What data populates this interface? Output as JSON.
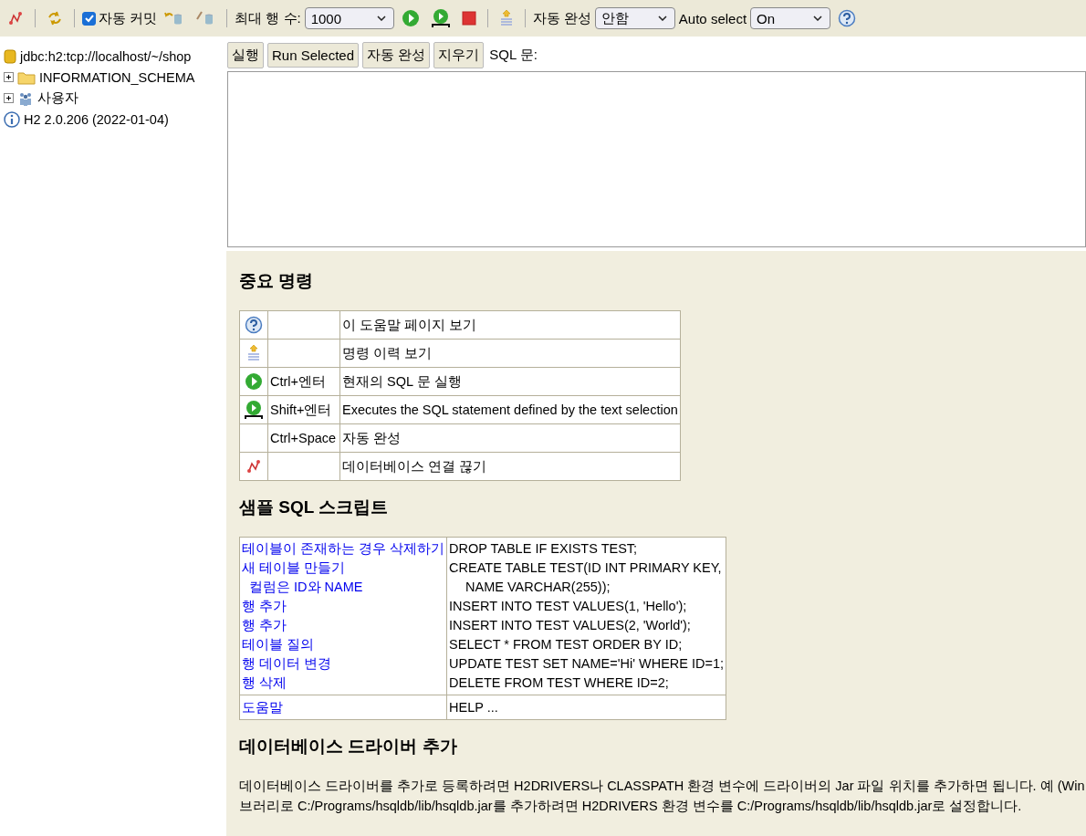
{
  "toolbar": {
    "auto_commit": {
      "label": "자동 커밋",
      "checked": true
    },
    "max_rows": {
      "label": "최대 행 수:",
      "value": "1000"
    },
    "autocomplete": {
      "label": "자동 완성",
      "value": "안함"
    },
    "auto_select": {
      "label": "Auto select",
      "value": "On"
    }
  },
  "tree": [
    {
      "kind": "connection",
      "label": "jdbc:h2:tcp://localhost/~/shop"
    },
    {
      "kind": "folder",
      "label": "INFORMATION_SCHEMA",
      "expanded": false
    },
    {
      "kind": "users",
      "label": "사용자",
      "expanded": false
    },
    {
      "kind": "info",
      "label": "H2 2.0.206 (2022-01-04)"
    }
  ],
  "editor": {
    "buttons": [
      "실행",
      "Run Selected",
      "자동 완성",
      "지우기"
    ],
    "label": "SQL 문:"
  },
  "help": {
    "title": "중요 명령",
    "commands": [
      {
        "kind": "help",
        "description": "이 도움말 페이지 보기"
      },
      {
        "kind": "history",
        "description": "명령 이력 보기"
      },
      {
        "kind": "run",
        "shortcut": "Ctrl+엔터",
        "description": "현재의 SQL 문 실행"
      },
      {
        "kind": "run_selected",
        "shortcut": "Shift+엔터",
        "description": "Executes the SQL statement defined by the text selection"
      },
      {
        "kind": "none",
        "shortcut": "Ctrl+Space",
        "description": "자동 완성"
      },
      {
        "kind": "disconnect",
        "description": "데이터베이스 연결 끊기"
      }
    ],
    "sample_title": "샘플 SQL 스크립트",
    "sample_rows": [
      {
        "label": "테이블이 존재하는 경우 삭제하기",
        "sql": "DROP TABLE IF EXISTS TEST;",
        "continuation": false
      },
      {
        "label": "새 테이블 만들기",
        "sql": "CREATE TABLE TEST(ID INT PRIMARY KEY,",
        "continuation": false
      },
      {
        "label": "컬럼은 ID와 NAME",
        "sql": "NAME VARCHAR(255));",
        "continuation": true
      },
      {
        "label": "행 추가",
        "sql": "INSERT INTO TEST VALUES(1, 'Hello');",
        "continuation": false
      },
      {
        "label": "행 추가",
        "sql": "INSERT INTO TEST VALUES(2, 'World');",
        "continuation": false
      },
      {
        "label": "테이블 질의",
        "sql": "SELECT * FROM TEST ORDER BY ID;",
        "continuation": false
      },
      {
        "label": "행 데이터 변경",
        "sql": "UPDATE TEST SET NAME='Hi' WHERE ID=1;",
        "continuation": false
      },
      {
        "label": "행 삭제",
        "sql": "DELETE FROM TEST WHERE ID=2;",
        "continuation": false
      }
    ],
    "sample_footer": {
      "label": "도움말",
      "sql": "HELP ..."
    },
    "driver_title": "데이터베이스 드라이버 추가",
    "driver_lines": [
      "데이터베이스 드라이버를 추가로 등록하려면 H2DRIVERS나 CLASSPATH 환경 변수에 드라이버의 Jar 파일 위치를 추가하면 됩니다. 예 (Win",
      "브러리로 C:/Programs/hsqldb/lib/hsqldb.jar를 추가하려면 H2DRIVERS 환경 변수를 C:/Programs/hsqldb/lib/hsqldb.jar로 설정합니다."
    ]
  }
}
